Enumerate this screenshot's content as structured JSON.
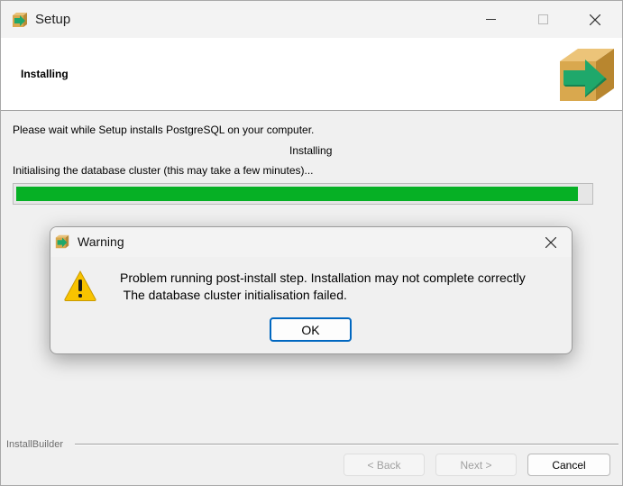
{
  "window": {
    "title": "Setup",
    "icon": "setup-arrow-box-icon"
  },
  "header": {
    "heading": "Installing",
    "logo": "setup-arrow-box-logo"
  },
  "content": {
    "message": "Please wait while Setup installs PostgreSQL on your computer.",
    "status": "Installing",
    "detail": "Initialising the database cluster (this may take a few minutes)...",
    "progress": 0.98
  },
  "footer": {
    "brand": "InstallBuilder",
    "back_label": "< Back",
    "next_label": "Next >",
    "cancel_label": "Cancel"
  },
  "dialog": {
    "title": "Warning",
    "icon": "warning-icon",
    "line1": "Problem running post-install step. Installation may not complete correctly",
    "line2": " The database cluster initialisation failed.",
    "ok_label": "OK"
  },
  "colors": {
    "progress_fill": "#06b025",
    "ok_border": "#0067c0",
    "warning_yellow": "#f8c300",
    "arrow_green": "#1fa86b",
    "box_tan": "#d9a84e"
  }
}
